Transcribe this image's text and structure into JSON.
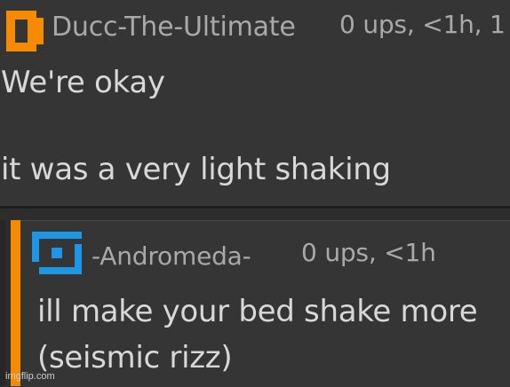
{
  "comment": {
    "username": "Ducc-The-Ultimate",
    "meta": "0 ups, <1h, 1",
    "avatar_icon": "orange-square-avatar-icon",
    "avatar_color": "#f68a00",
    "lines": [
      "We're okay",
      "it was a very light shaking"
    ]
  },
  "reply": {
    "username": "-Andromeda-",
    "meta": "0 ups, <1h",
    "avatar_icon": "blue-spiral-avatar-icon",
    "avatar_color": "#1e96e6",
    "accent_color": "#f68a00",
    "lines": [
      "ill make your bed shake more",
      "(seismic rizz)"
    ]
  },
  "watermark": "imgflip.com"
}
